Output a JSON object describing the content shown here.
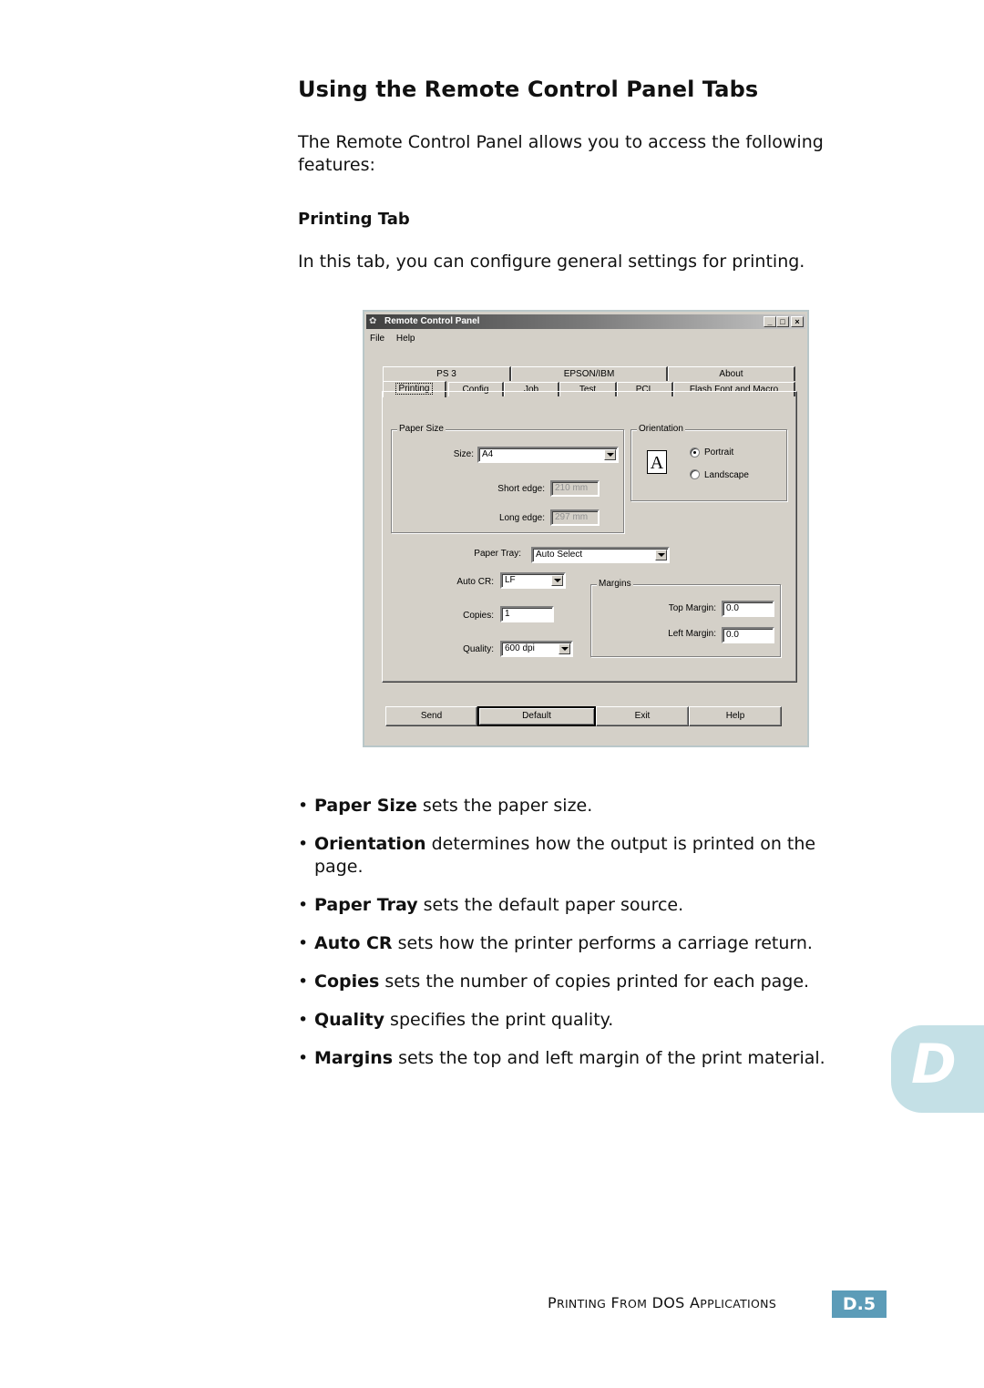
{
  "heading": "Using the Remote Control Panel Tabs",
  "intro": "The Remote Control Panel allows you to access the following features:",
  "subheading": "Printing Tab",
  "tab_description": "In this tab, you can configure general settings for printing.",
  "dialog": {
    "title": "Remote Control Panel",
    "title_buttons": {
      "minimize": "_",
      "maximize": "□",
      "close": "×"
    },
    "menu": [
      "File",
      "Help"
    ],
    "tabs_back": [
      "PS 3",
      "EPSON/IBM",
      "About"
    ],
    "tabs_front": [
      "Printing",
      "Config",
      "Job",
      "Test",
      "PCL",
      "Flash Font and Macro"
    ],
    "active_tab": "Printing",
    "paper_size": {
      "group_label": "Paper Size",
      "size_label": "Size:",
      "size_value": "A4",
      "short_edge_label": "Short edge:",
      "short_edge_value": "210 mm",
      "long_edge_label": "Long edge:",
      "long_edge_value": "297 mm"
    },
    "orientation": {
      "group_label": "Orientation",
      "icon_letter": "A",
      "options": [
        "Portrait",
        "Landscape"
      ],
      "selected": "Portrait"
    },
    "paper_tray": {
      "label": "Paper Tray:",
      "value": "Auto Select"
    },
    "auto_cr": {
      "label": "Auto CR:",
      "value": "LF"
    },
    "copies": {
      "label": "Copies:",
      "value": "1"
    },
    "quality": {
      "label": "Quality:",
      "value": "600 dpi"
    },
    "margins": {
      "group_label": "Margins",
      "top_label": "Top Margin:",
      "top_value": "0.0",
      "left_label": "Left Margin:",
      "left_value": "0.0"
    },
    "buttons": [
      "Send",
      "Default",
      "Exit",
      "Help"
    ]
  },
  "bullets": [
    {
      "term": "Paper Size",
      "text": " sets the paper size."
    },
    {
      "term": "Orientation",
      "text": " determines how the output is printed on the page."
    },
    {
      "term": "Paper Tray",
      "text": " sets the default paper source."
    },
    {
      "term": "Auto CR",
      "text": " sets how the printer performs a carriage return."
    },
    {
      "term": "Copies",
      "text": " sets the number of copies printed for each page."
    },
    {
      "term": "Quality",
      "text": " specifies the print quality."
    },
    {
      "term": "Margins",
      "text": " sets the top and left margin of the print material."
    }
  ],
  "chapter_tab": "D",
  "footer": {
    "section_parts": [
      {
        "big": "P",
        "small": "RINTING"
      },
      {
        "big": "F",
        "small": "ROM"
      },
      {
        "big": "DOS",
        "small": ""
      },
      {
        "big": "A",
        "small": "PPLICATIONS"
      }
    ],
    "page_number": "D.5",
    "badge_color": "#5c9cb8"
  }
}
